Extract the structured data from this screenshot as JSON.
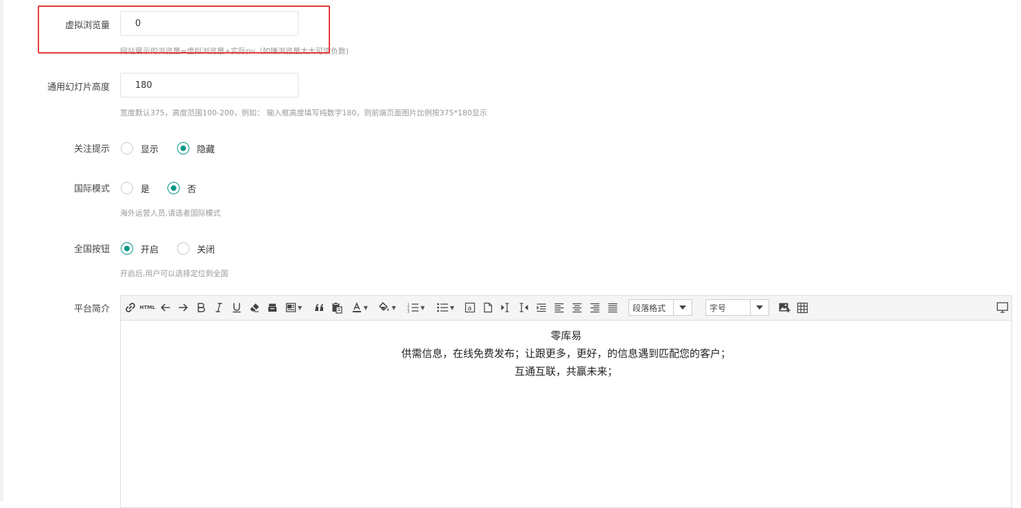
{
  "form": {
    "virtual_views": {
      "label": "虚拟浏览量",
      "value": "0",
      "hint": "网站展示的浏览量=虚拟浏览量+实际pv（如嫌浏览量太大可填负数)"
    },
    "slide_height": {
      "label": "通用幻灯片高度",
      "value": "180",
      "hint": "宽度默认375，高度范围100-200，例如： 输入框高度填写纯数字180，则前端页面图片比例按375*180显示"
    },
    "follow_tip": {
      "label": "关注提示",
      "options": [
        "显示",
        "隐藏"
      ],
      "selected": "隐藏"
    },
    "intl_mode": {
      "label": "国际模式",
      "options": [
        "是",
        "否"
      ],
      "selected": "否",
      "hint": "海外运营人员,请选者国际模式"
    },
    "national_button": {
      "label": "全国按钮",
      "options": [
        "开启",
        "关闭"
      ],
      "selected": "开启",
      "hint": "开启后,用户可以选择定位到全国"
    },
    "platform_intro": {
      "label": "平台简介",
      "toolbar": {
        "html_label": "HTML",
        "paragraph_format": "段落格式",
        "font_size": "字号"
      },
      "content_lines": [
        "零库易",
        "供需信息，在线免费发布；让跟更多，更好，的信息遇到匹配您的客户；",
        "互通互联，共赢未来；"
      ]
    }
  },
  "colors": {
    "accent": "#009688",
    "highlight_border": "#e53935",
    "hint_text": "#999999"
  },
  "icons": [
    "link-icon",
    "html-icon",
    "undo-icon",
    "redo-icon",
    "bold-icon",
    "italic-icon",
    "underline-icon",
    "eraser-icon",
    "format-brush-icon",
    "block-format-icon",
    "quote-icon",
    "paste-icon",
    "font-color-icon",
    "background-color-icon",
    "ordered-list-icon",
    "unordered-list-icon",
    "text-box-icon",
    "page-icon",
    "indent-icon",
    "outdent-icon",
    "paragraph-indent-icon",
    "align-left-icon",
    "align-center-icon",
    "align-right-icon",
    "align-justify-icon",
    "image-icon",
    "table-icon",
    "fullscreen-icon"
  ]
}
